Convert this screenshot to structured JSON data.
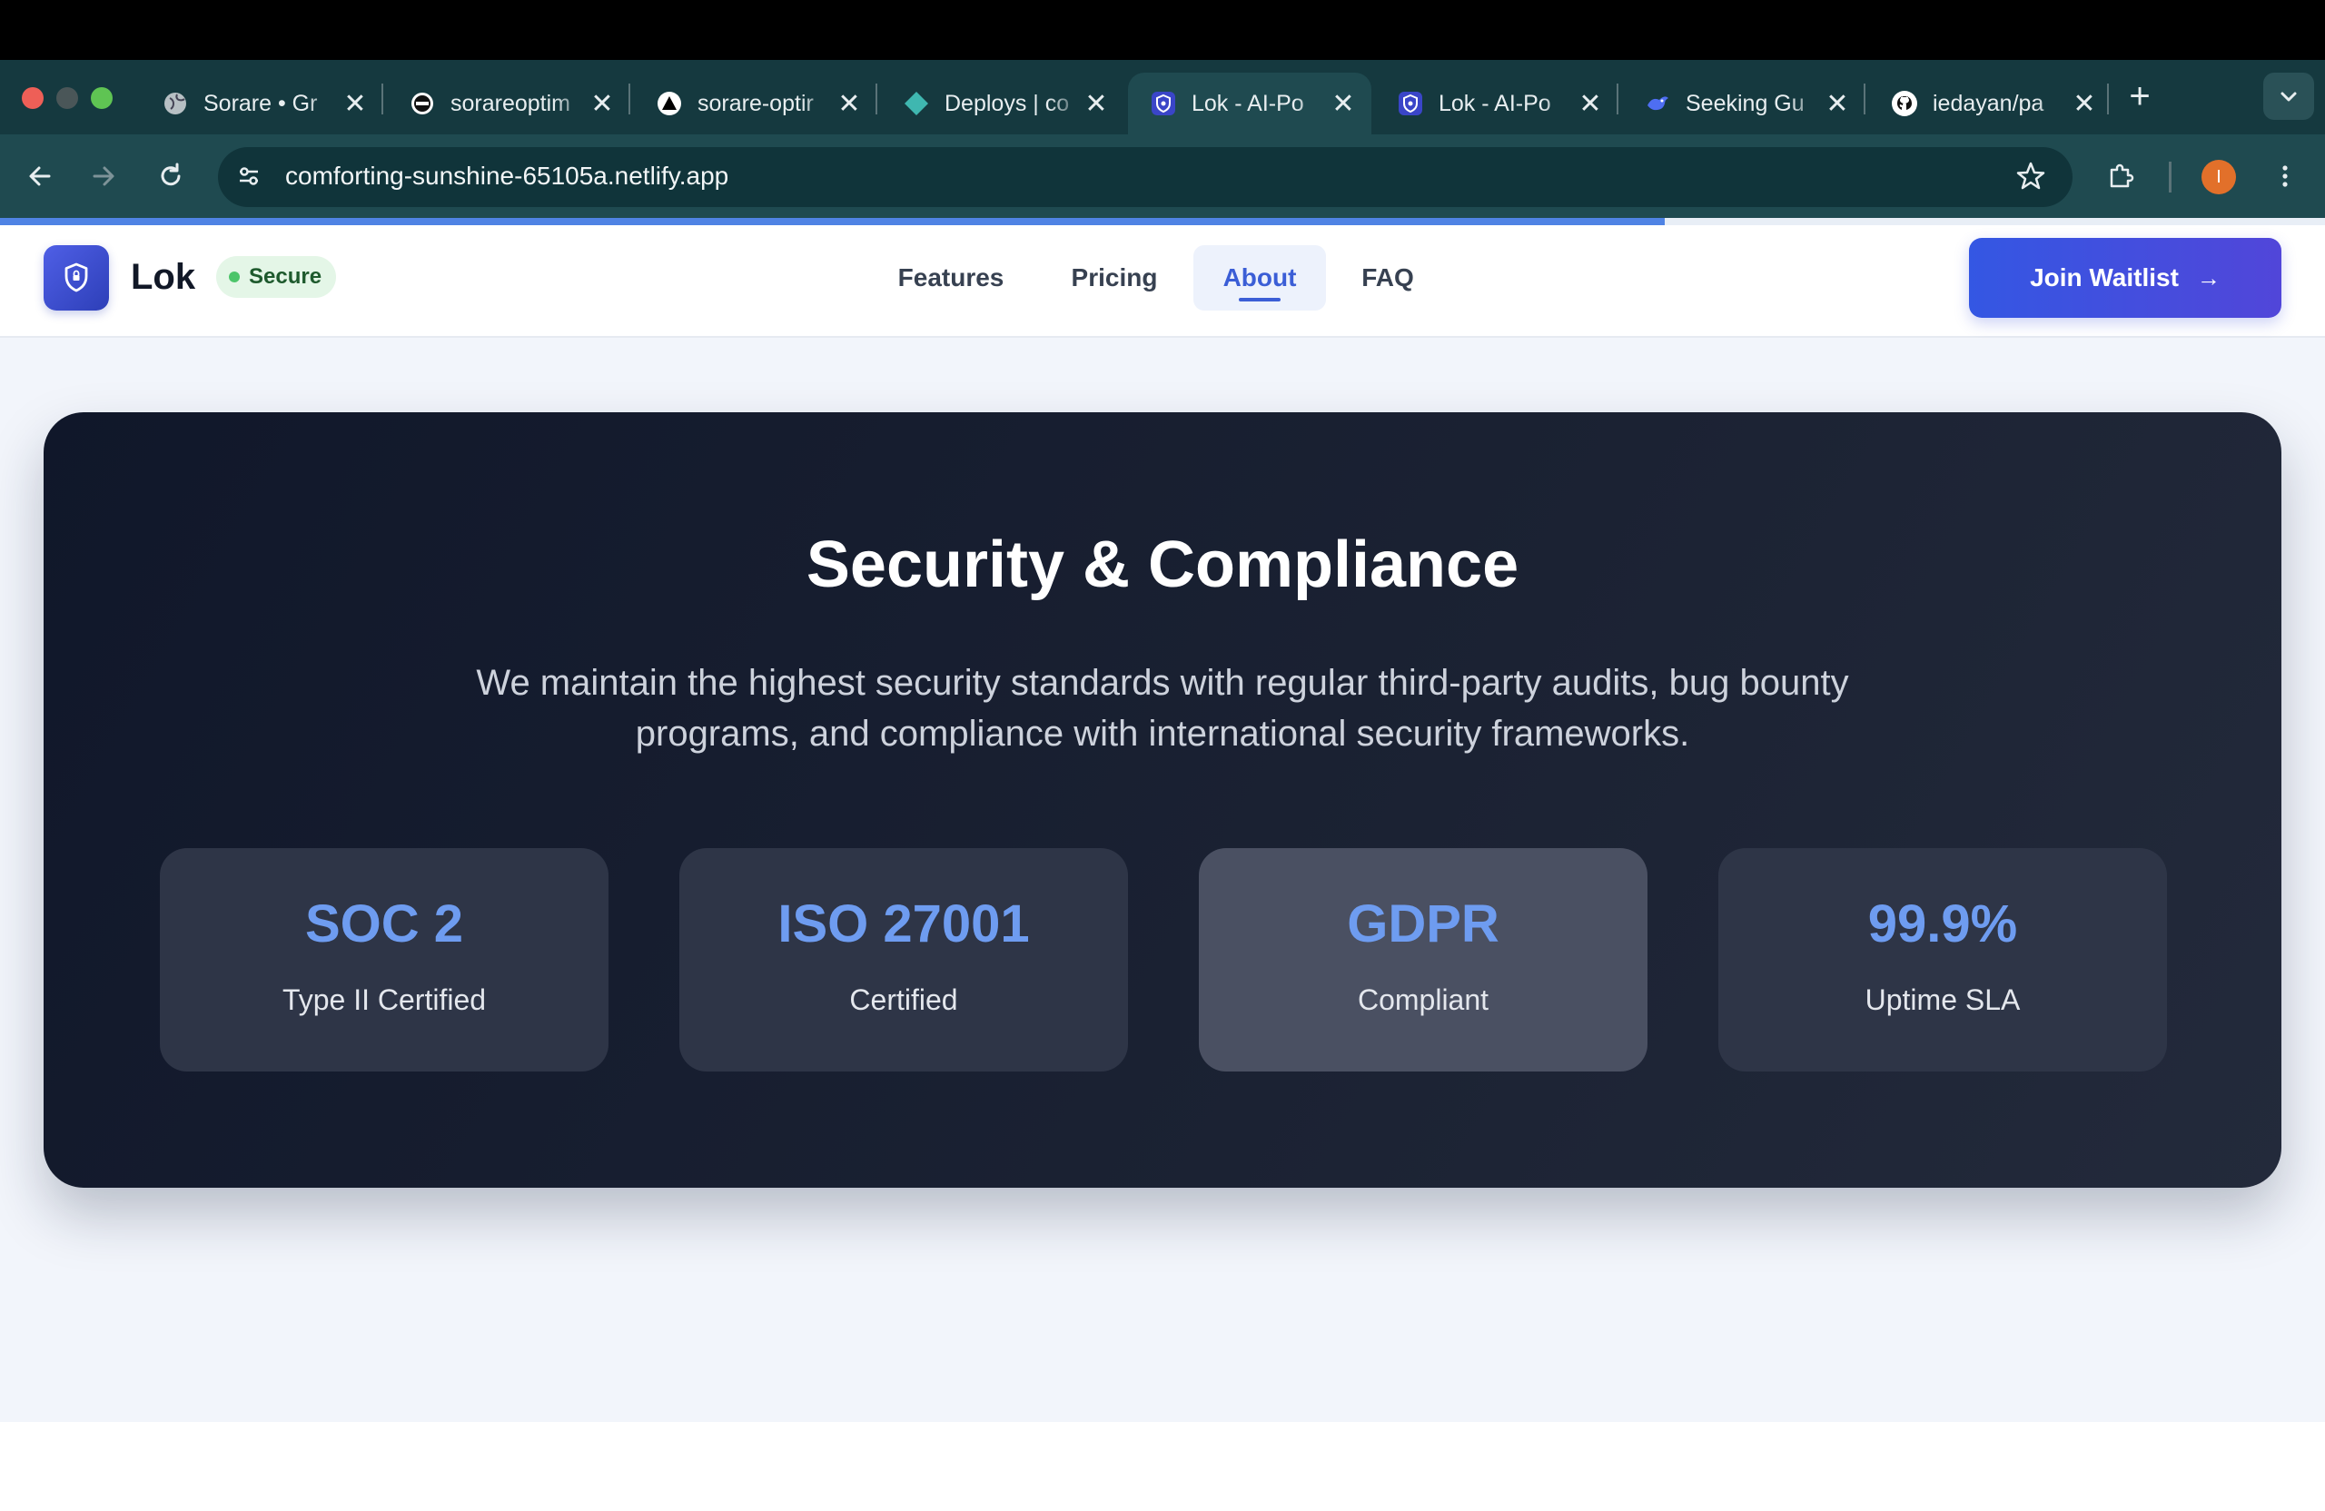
{
  "browser": {
    "tabs": [
      {
        "title": "Sorare • Gr",
        "icon": "globe-icon",
        "active": false
      },
      {
        "title": "sorareoptim",
        "icon": "site-icon",
        "active": false
      },
      {
        "title": "sorare-optir",
        "icon": "triangle-icon",
        "active": false
      },
      {
        "title": "Deploys | co",
        "icon": "netlify-diamond-icon",
        "active": false
      },
      {
        "title": "Lok - AI-Po",
        "icon": "shield-icon",
        "active": true
      },
      {
        "title": "Lok - AI-Po",
        "icon": "shield-icon",
        "active": false
      },
      {
        "title": "Seeking Gu",
        "icon": "bird-icon",
        "active": false
      },
      {
        "title": "iedayan/pa",
        "icon": "github-icon",
        "active": false
      }
    ],
    "close_glyph": "✕",
    "new_tab_glyph": "+",
    "url": "comforting-sunshine-65105a.netlify.app",
    "profile_initial": "I",
    "load_progress": 0.716
  },
  "site": {
    "brand": "Lok",
    "badge": "Secure",
    "nav": [
      "Features",
      "Pricing",
      "About",
      "FAQ"
    ],
    "active_nav": "About",
    "cta": "Join Waitlist",
    "cta_arrow": "→"
  },
  "security": {
    "title": "Security & Compliance",
    "description_line1": "We maintain the highest security standards with regular third-party audits, bug bounty",
    "description_line2": "programs, and compliance with international security frameworks.",
    "stats": [
      {
        "value": "SOC 2",
        "label": "Type II Certified"
      },
      {
        "value": "ISO 27001",
        "label": "Certified"
      },
      {
        "value": "GDPR",
        "label": "Compliant"
      },
      {
        "value": "99.9%",
        "label": "Uptime SLA"
      }
    ]
  },
  "colors": {
    "tab_strip": "#15393f",
    "toolbar": "#1f4a50",
    "accent": "#3b5ed6",
    "stat_value": "#6e9cf0",
    "card_bg": "#1b2233"
  }
}
